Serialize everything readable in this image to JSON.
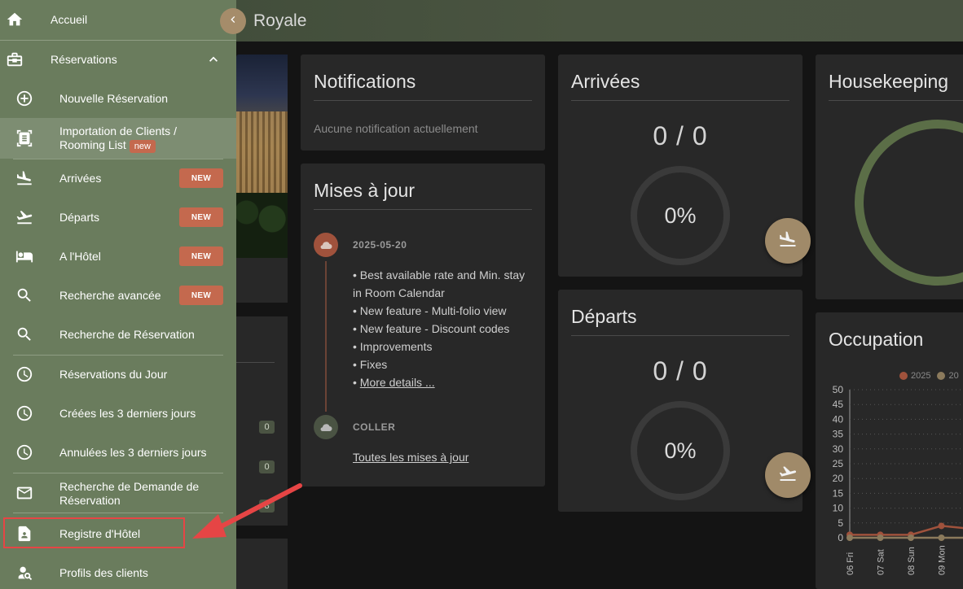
{
  "header": {
    "hotel_name": "Royale"
  },
  "sidebar": {
    "home": "Accueil",
    "reservations": "Réservations",
    "items": [
      {
        "label": "Nouvelle Réservation"
      },
      {
        "label_line1": "Importation de Clients /",
        "label_line2": "Rooming List",
        "badge": "new"
      },
      {
        "label": "Arrivées",
        "badge": "NEW"
      },
      {
        "label": "Départs",
        "badge": "NEW"
      },
      {
        "label": "A l'Hôtel",
        "badge": "NEW"
      },
      {
        "label": "Recherche avancée",
        "badge": "NEW"
      },
      {
        "label": "Recherche de Réservation"
      },
      {
        "label": "Réservations du Jour"
      },
      {
        "label": "Créées les 3 derniers jours"
      },
      {
        "label": "Annulées les 3 derniers jours"
      },
      {
        "label_line1": "Recherche de Demande de",
        "label_line2": "Réservation"
      },
      {
        "label": "Registre d'Hôtel"
      },
      {
        "label": "Profils des clients"
      }
    ]
  },
  "background_counts": [
    "0",
    "0",
    "8"
  ],
  "notifications": {
    "title": "Notifications",
    "empty": "Aucune notification actuellement"
  },
  "updates": {
    "title": "Mises à jour",
    "date": "2025-05-20",
    "lines": [
      "• Best available rate and Min. stay",
      "in Room Calendar",
      "• New feature - Multi-folio view",
      "• New feature - Discount codes",
      "• Improvements",
      "• Fixes"
    ],
    "more_prefix": "• ",
    "more_link": "More details ...",
    "second_label": "COLLER",
    "all_link": "Toutes les mises à jour"
  },
  "arrivals": {
    "title": "Arrivées",
    "count": "0 / 0",
    "percent": "0%"
  },
  "departures": {
    "title": "Départs",
    "count": "0 / 0",
    "percent": "0%"
  },
  "housekeeping": {
    "title": "Housekeeping"
  },
  "occupation": {
    "title": "Occupation",
    "legend": [
      "2025",
      "20"
    ],
    "colors": {
      "current": "#a0523c",
      "previous": "#8b7a5c"
    }
  },
  "chart_data": {
    "type": "line",
    "title": "Occupation",
    "categories": [
      "06 Fri",
      "07 Sat",
      "08 Sun",
      "09 Mon"
    ],
    "series": [
      {
        "name": "2025",
        "values": [
          1,
          1,
          1,
          4,
          3
        ]
      },
      {
        "name": "20",
        "values": [
          0,
          0,
          0,
          0,
          0
        ]
      }
    ],
    "yticks": [
      "50",
      "45",
      "40",
      "35",
      "30",
      "25",
      "20",
      "15",
      "10",
      "5",
      "0"
    ],
    "ylim": [
      0,
      50
    ],
    "grid": true
  }
}
